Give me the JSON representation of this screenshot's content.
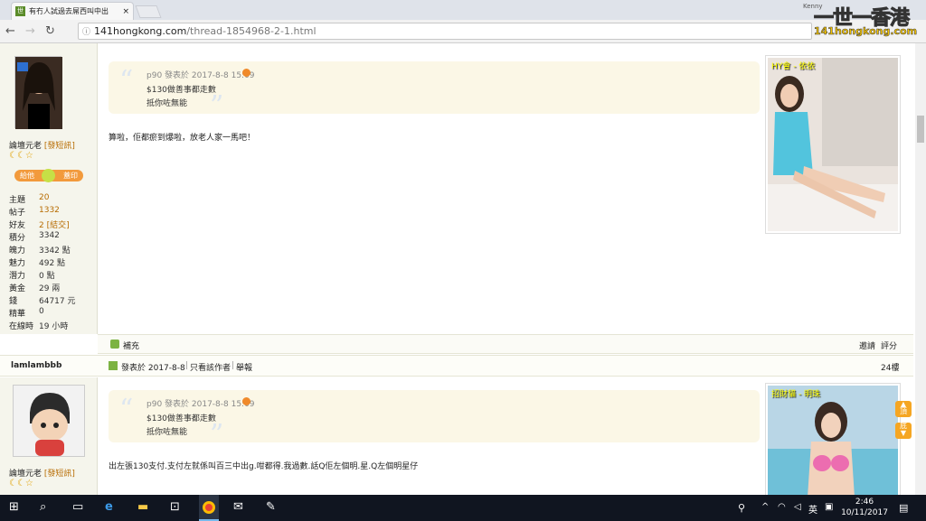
{
  "browser": {
    "tab_title": "有冇人試過去屌西叫中出",
    "tab_close": "×",
    "url_host": "141hongkong.com",
    "url_path": "/thread-1854968-2-1.html"
  },
  "brand": {
    "kenny": "Kenny",
    "name": "一世一香港",
    "url": "141hongkong.com"
  },
  "post1": {
    "user_rank": "論壇元老",
    "pm_link": "[發短訊]",
    "stars": "☾☾☆",
    "give_btn": "給他",
    "stamp_btn": "蓋印",
    "stats": [
      {
        "k": "主題",
        "v": "20"
      },
      {
        "k": "帖子",
        "v": "1332"
      },
      {
        "k": "好友",
        "v": "2 [結交]"
      },
      {
        "k": "積分",
        "v": "3342"
      },
      {
        "k": "魄力",
        "v": "3342 點"
      },
      {
        "k": "魅力",
        "v": "492 點"
      },
      {
        "k": "潛力",
        "v": "0 點"
      },
      {
        "k": "黃金",
        "v": "29 兩"
      },
      {
        "k": "錢",
        "v": "64717 元"
      },
      {
        "k": "精華",
        "v": "0"
      },
      {
        "k": "在線時",
        "v": "19 小時"
      }
    ],
    "quote_meta": "p90 發表於 2017-8-8 15:09",
    "quote_line1": "$130做善事都走數",
    "quote_line2": "抵你咗無能",
    "body": "算啦，佢都瘀到爆啦，放老人家一馬吧！",
    "ad_title": "HY會 - 依依",
    "supplement": "補充",
    "invite": "邀請",
    "rate": "評分"
  },
  "post2": {
    "username": "lamlambbb",
    "posted": "發表於 2017-8-8",
    "only_author": "只看該作者",
    "report": "舉報",
    "floor": "24樓",
    "user_rank": "論壇元老",
    "pm_link": "[發短訊]",
    "stars": "☾☾☆",
    "quote_meta": "p90 發表於 2017-8-8 15:09",
    "quote_line1": "$130做善事都走數",
    "quote_line2": "抵你咗無能",
    "body": "出左張130支付.支付左就係叫百三中出g.咁都得.我過數.話Q佢左個明.星.Q左個明星仔",
    "ad_title": "招財貓 - 明珠",
    "top_btn": "頂",
    "bottom_btn": "底"
  },
  "taskbar": {
    "time": "2:46",
    "date": "10/11/2017",
    "lang": "英"
  }
}
